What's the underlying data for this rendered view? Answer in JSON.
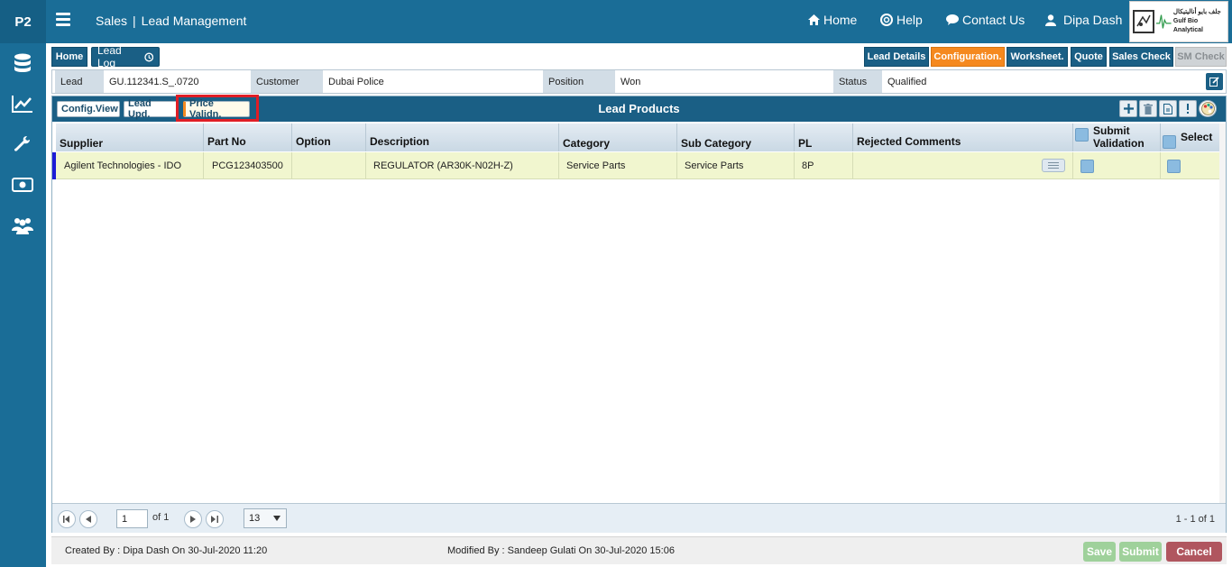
{
  "app": {
    "brand": "P2",
    "module": "Sales",
    "separator": "|",
    "page": "Lead Management"
  },
  "topnav": {
    "home": "Home",
    "help": "Help",
    "contact": "Contact Us",
    "user": "Dipa Dash"
  },
  "logo": {
    "arabic": "جلف بايو أناليتيكال",
    "english": "Gulf Bio Analytical"
  },
  "breadcrumb": {
    "home": "Home",
    "lead_log": "Lead Log"
  },
  "tabs": {
    "lead_details": "Lead Details",
    "configuration": "Configuration.",
    "worksheet": "Worksheet.",
    "quote": "Quote",
    "sales_check": "Sales Check",
    "sm_check": "SM Check"
  },
  "info": {
    "lead_label": "Lead",
    "lead_value": "GU.112341.S_.0720",
    "customer_label": "Customer",
    "customer_value": "Dubai Police",
    "position_label": "Position",
    "position_value": "Won",
    "status_label": "Status",
    "status_value": "Qualified"
  },
  "panel": {
    "title": "Lead Products",
    "btn_config_view": "Config.View",
    "btn_lead_upd": "Lead Upd.",
    "btn_price_validn": "Price Validn."
  },
  "columns": {
    "supplier": "Supplier",
    "part_no": "Part No",
    "option": "Option",
    "description": "Description",
    "category": "Category",
    "sub_category": "Sub Category",
    "pl": "PL",
    "rejected_comments": "Rejected Comments",
    "submit_validation_1": "Submit",
    "submit_validation_2": "Validation",
    "select": "Select"
  },
  "rows": [
    {
      "supplier": "Agilent Technologies - IDO",
      "part_no": "PCG123403500",
      "option": "",
      "description": "REGULATOR (AR30K-N02H-Z)",
      "category": "Service Parts",
      "sub_category": "Service Parts",
      "pl": "8P",
      "rejected_comments": ""
    }
  ],
  "pager": {
    "page": "1",
    "of": "of 1",
    "page_size": "13",
    "range": "1 - 1 of 1"
  },
  "footer": {
    "created": "Created By : Dipa Dash On 30-Jul-2020 11:20",
    "modified": "Modified By : Sandeep Gulati On 30-Jul-2020 15:06",
    "save": "Save",
    "submit": "Submit",
    "cancel": "Cancel"
  },
  "colors": {
    "primary": "#1a6d97",
    "active_tab": "#f5891f",
    "row_bg": "#f1f6cf",
    "save_bg": "#9fd19b",
    "cancel_bg": "#b0565f"
  }
}
